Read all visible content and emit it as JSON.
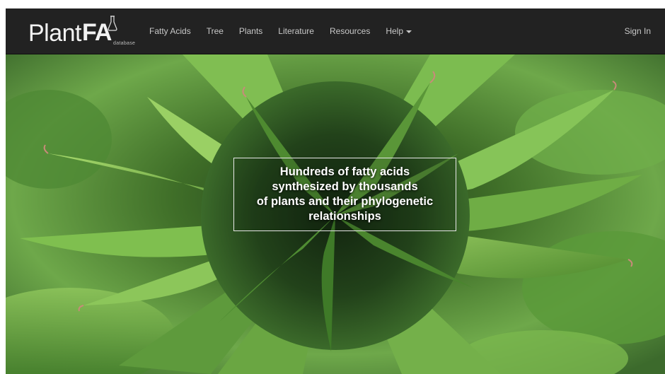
{
  "brand": {
    "name_part1": "Plant",
    "name_part2": "FA",
    "subtitle": "database",
    "logo_icon": "flask-icon"
  },
  "nav": {
    "items": [
      {
        "label": "Fatty Acids"
      },
      {
        "label": "Tree"
      },
      {
        "label": "Plants"
      },
      {
        "label": "Literature"
      },
      {
        "label": "Resources"
      },
      {
        "label": "Help",
        "dropdown": true
      }
    ],
    "signin_label": "Sign In"
  },
  "hero": {
    "caption_lines": [
      "Hundreds of fatty acids",
      "synthesized by thousands",
      "of plants and their phylogenetic",
      "relationships"
    ]
  },
  "colors": {
    "navbar_bg": "#222222",
    "nav_text": "#c8c8c8",
    "brand_text": "#f2f2f2",
    "caption_text": "#ffffff",
    "caption_border": "#e8e8e8"
  }
}
